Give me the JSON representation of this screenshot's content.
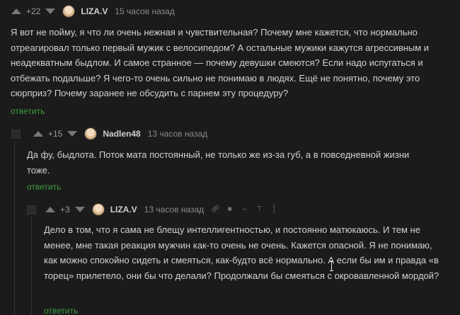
{
  "comments": [
    {
      "rating": "+22",
      "nick": "LIZA.V",
      "time": "15 часов назад",
      "text": "Я вот не пойму, я что ли очень нежная и чувствительная? Почему мне кажется, что нормально отреагировал только первый мужик с велосипедом? А остальные мужики кажутся агрессивным и неадекватным быдлом. И самое странное — почему девушки смеются? Если надо испугаться и отбежать подальше? Я чего-то очень сильно не понимаю в людях. Ещё не понятно, почему это сюрприз? Почему заранее не обсудить с парнем эту процедуру?",
      "reply": "ответить"
    },
    {
      "rating": "+15",
      "nick": "Nadlen48",
      "time": "13 часов назад",
      "text": "Да фу, быдлота. Поток мата постоянный, не только же из-за губ, а в повседневной жизни тоже.",
      "reply": "ответить"
    },
    {
      "rating": "+3",
      "nick": "LIZA.V",
      "time": "13 часов назад",
      "text": "Дело в том, что я сама не блещу интеллигентностью, и постоянно матюкаюсь. И тем не менее, мне такая реакция мужчин как-то очень не очень. Кажется опасной. Я не понимаю, как можно спокойно сидеть и смеяться, как-будто всё нормально. А если бы им и правда «в торец» прилетело, они бы что делали? Продолжали бы смеяться с окровавленной мордой?",
      "reply": "ответить"
    }
  ],
  "tool_icons": [
    "link-icon",
    "save-icon",
    "minus-icon",
    "pin-icon",
    "more-icon"
  ],
  "colors": {
    "background": "#1b1b1b",
    "reply": "#3c9c3c",
    "text": "#d2d2d2"
  }
}
